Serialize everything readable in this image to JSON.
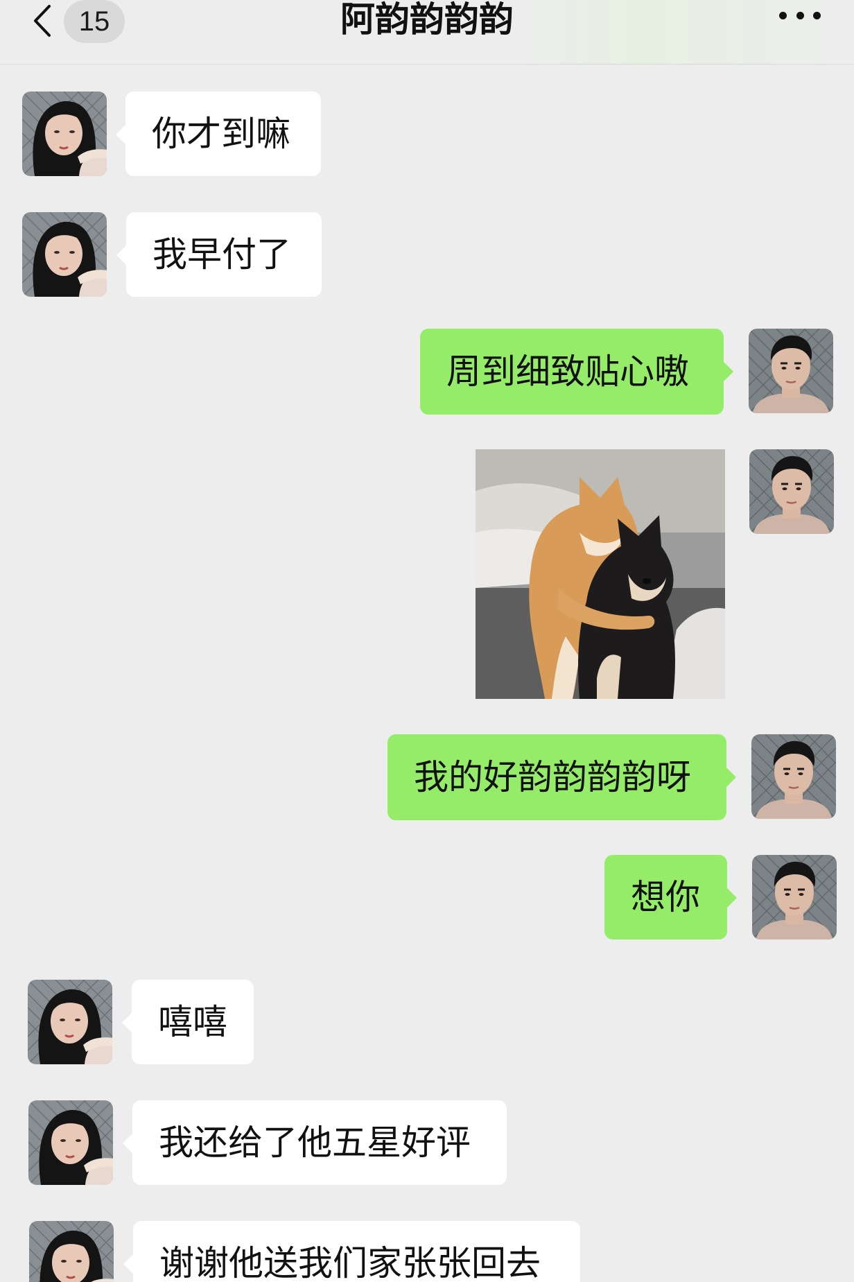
{
  "header": {
    "unread_count": "15",
    "title": "阿韵韵韵韵",
    "back_icon": "chevron-left-icon",
    "more_icon": "more-dots-icon"
  },
  "messages": [
    {
      "side": "in",
      "type": "text",
      "text": "你才到嘛"
    },
    {
      "side": "in",
      "type": "text",
      "text": "我早付了"
    },
    {
      "side": "out",
      "type": "text",
      "text": "周到细致贴心嗷"
    },
    {
      "side": "out",
      "type": "image",
      "image": "two-shiba-dogs-hugging"
    },
    {
      "side": "out",
      "type": "text",
      "text": "我的好韵韵韵韵呀"
    },
    {
      "side": "out",
      "type": "text",
      "text": "想你"
    },
    {
      "side": "in",
      "type": "text",
      "text": "嘻嘻"
    },
    {
      "side": "in",
      "type": "text",
      "text": "我还给了他五星好评"
    },
    {
      "side": "in",
      "type": "text",
      "text": "谢谢他送我们家张张回去"
    }
  ],
  "colors": {
    "background": "#ededed",
    "incoming_bubble": "#ffffff",
    "outgoing_bubble": "#95ec69"
  }
}
